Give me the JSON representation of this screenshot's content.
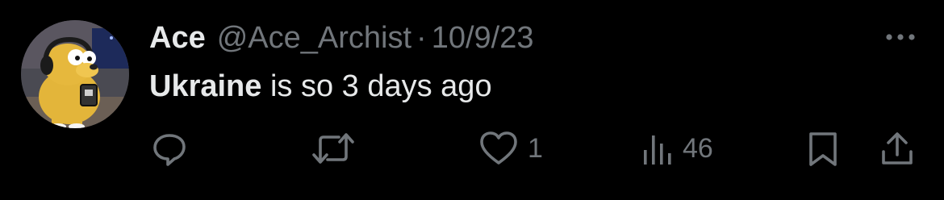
{
  "tweet": {
    "display_name": "Ace",
    "handle": "@Ace_Archist",
    "separator": "·",
    "date": "10/9/23",
    "text_mention": "Ukraine",
    "text_rest": " is so 3 days ago",
    "more_icon": "more-horizontal-icon"
  },
  "actions": {
    "reply": {
      "icon": "reply-icon",
      "count": ""
    },
    "retweet": {
      "icon": "retweet-icon",
      "count": ""
    },
    "like": {
      "icon": "heart-icon",
      "count": "1"
    },
    "views": {
      "icon": "views-chart-icon",
      "count": "46"
    },
    "bookmark": {
      "icon": "bookmark-icon"
    },
    "share": {
      "icon": "share-icon"
    }
  },
  "colors": {
    "background": "#000000",
    "primary_text": "#e7e9ea",
    "secondary_text": "#71767b"
  }
}
